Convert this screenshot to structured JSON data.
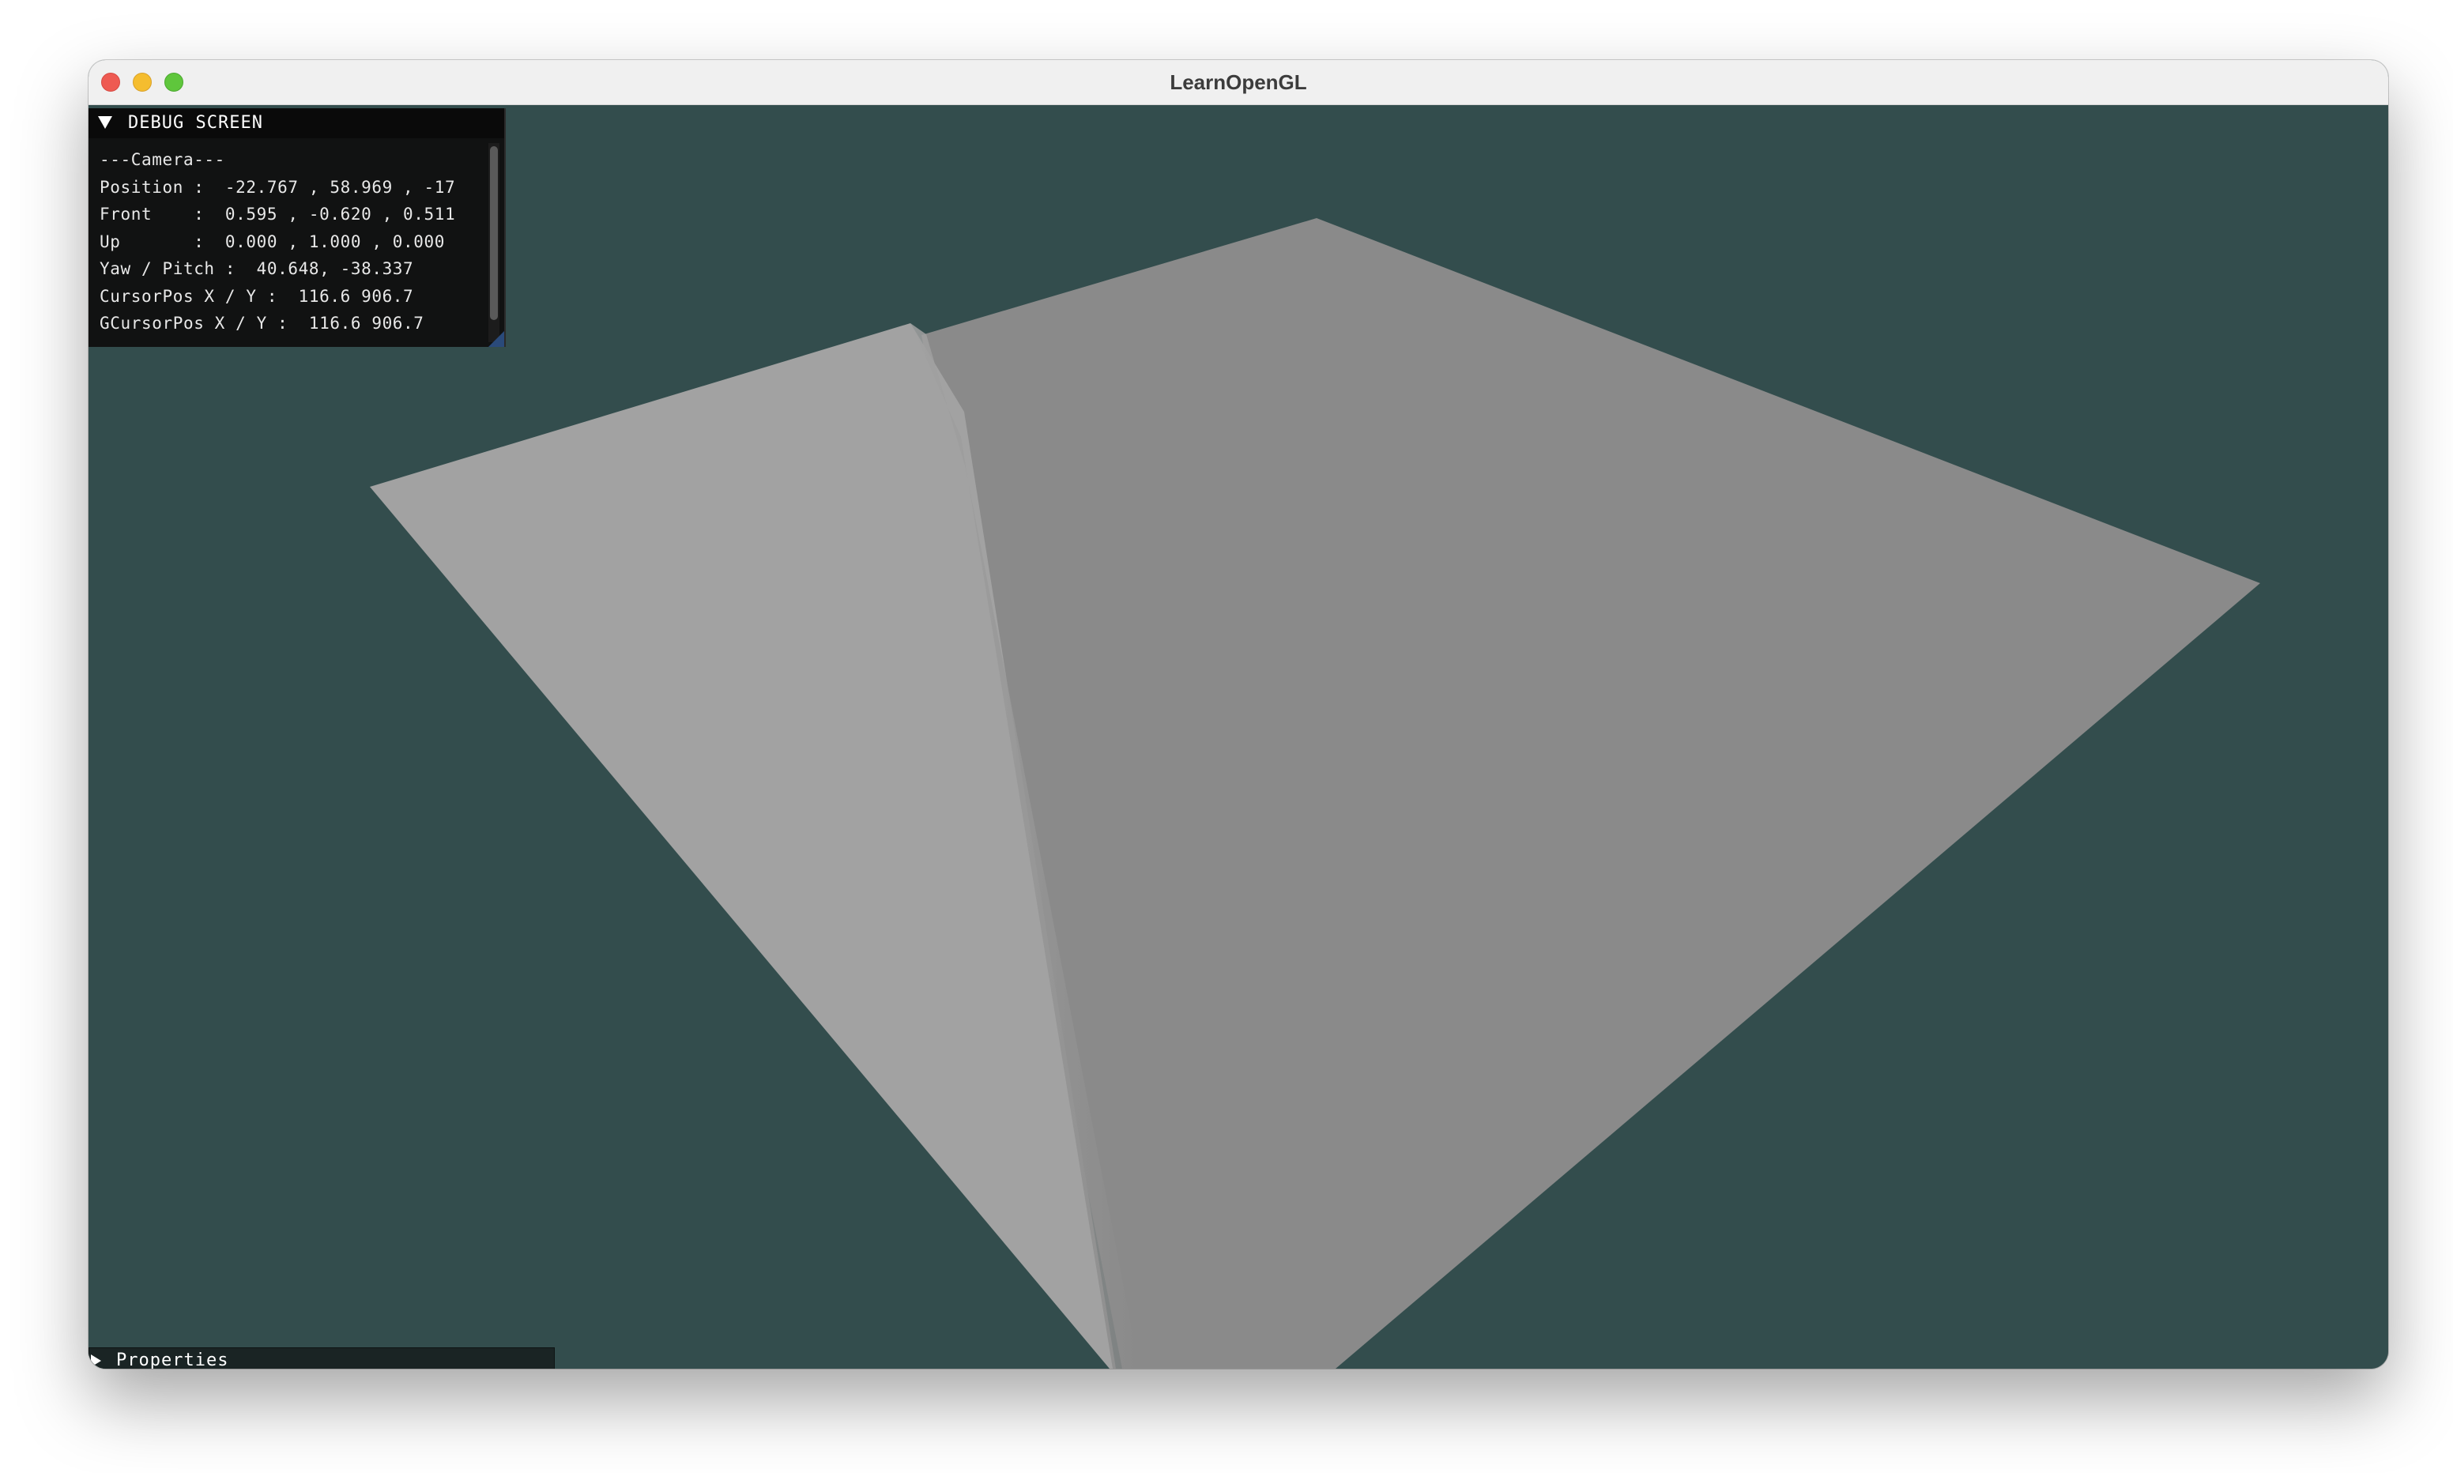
{
  "window": {
    "title": "LearnOpenGL"
  },
  "colors": {
    "clear_color": "#334d4d",
    "plane_left": "#a2a2a2",
    "plane_right": "#8a8a8a"
  },
  "debug_screen": {
    "title": "DEBUG SCREEN",
    "lines": [
      "---Camera---",
      "Position :  -22.767 , 58.969 , -17",
      "Front    :  0.595 , -0.620 , 0.511",
      "Up       :  0.000 , 1.000 , 0.000",
      "Yaw / Pitch :  40.648, -38.337",
      "CursorPos X / Y :  116.6 906.7",
      "GCursorPos X / Y :  116.6 906.7"
    ]
  },
  "properties_panel": {
    "title": "Properties"
  },
  "icons": {
    "close": "close-traffic-light-icon",
    "minimize": "minimize-traffic-light-icon",
    "zoom": "zoom-traffic-light-icon",
    "debug_collapse": "triangle-down-icon",
    "properties_expand": "triangle-right-icon"
  }
}
